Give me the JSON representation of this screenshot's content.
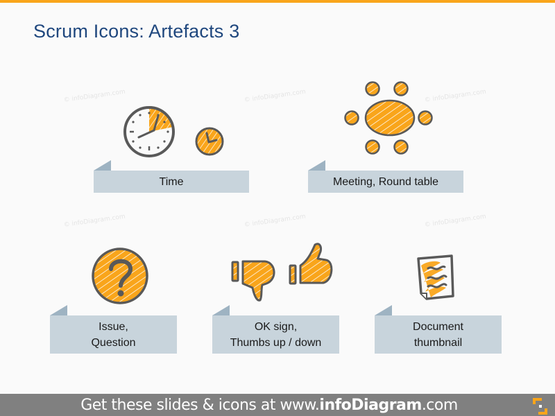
{
  "slide": {
    "title": "Scrum Icons: Artefacts 3",
    "watermark": "© infoDiagram.com",
    "accent_color": "#f9a51b",
    "stroke_color": "#595959",
    "label_bg_color": "#c8d4dc",
    "title_color": "#1f477e"
  },
  "items": [
    {
      "icon": "clock-icon",
      "label": "Time"
    },
    {
      "icon": "round-table-icon",
      "label": "Meeting, Round table"
    },
    {
      "icon": "question-icon",
      "label_line1": "Issue,",
      "label_line2": "Question"
    },
    {
      "icon": "thumbs-up-down-icon",
      "label_line1": "OK sign,",
      "label_line2": "Thumbs up / down"
    },
    {
      "icon": "document-icon",
      "label_line1": "Document",
      "label_line2": "thumbnail"
    }
  ],
  "footer": {
    "prefix": "Get these slides & icons at www.",
    "brand": "infoDiagram",
    "suffix": ".com",
    "logo_icon": "infodiagram-logo-icon"
  }
}
